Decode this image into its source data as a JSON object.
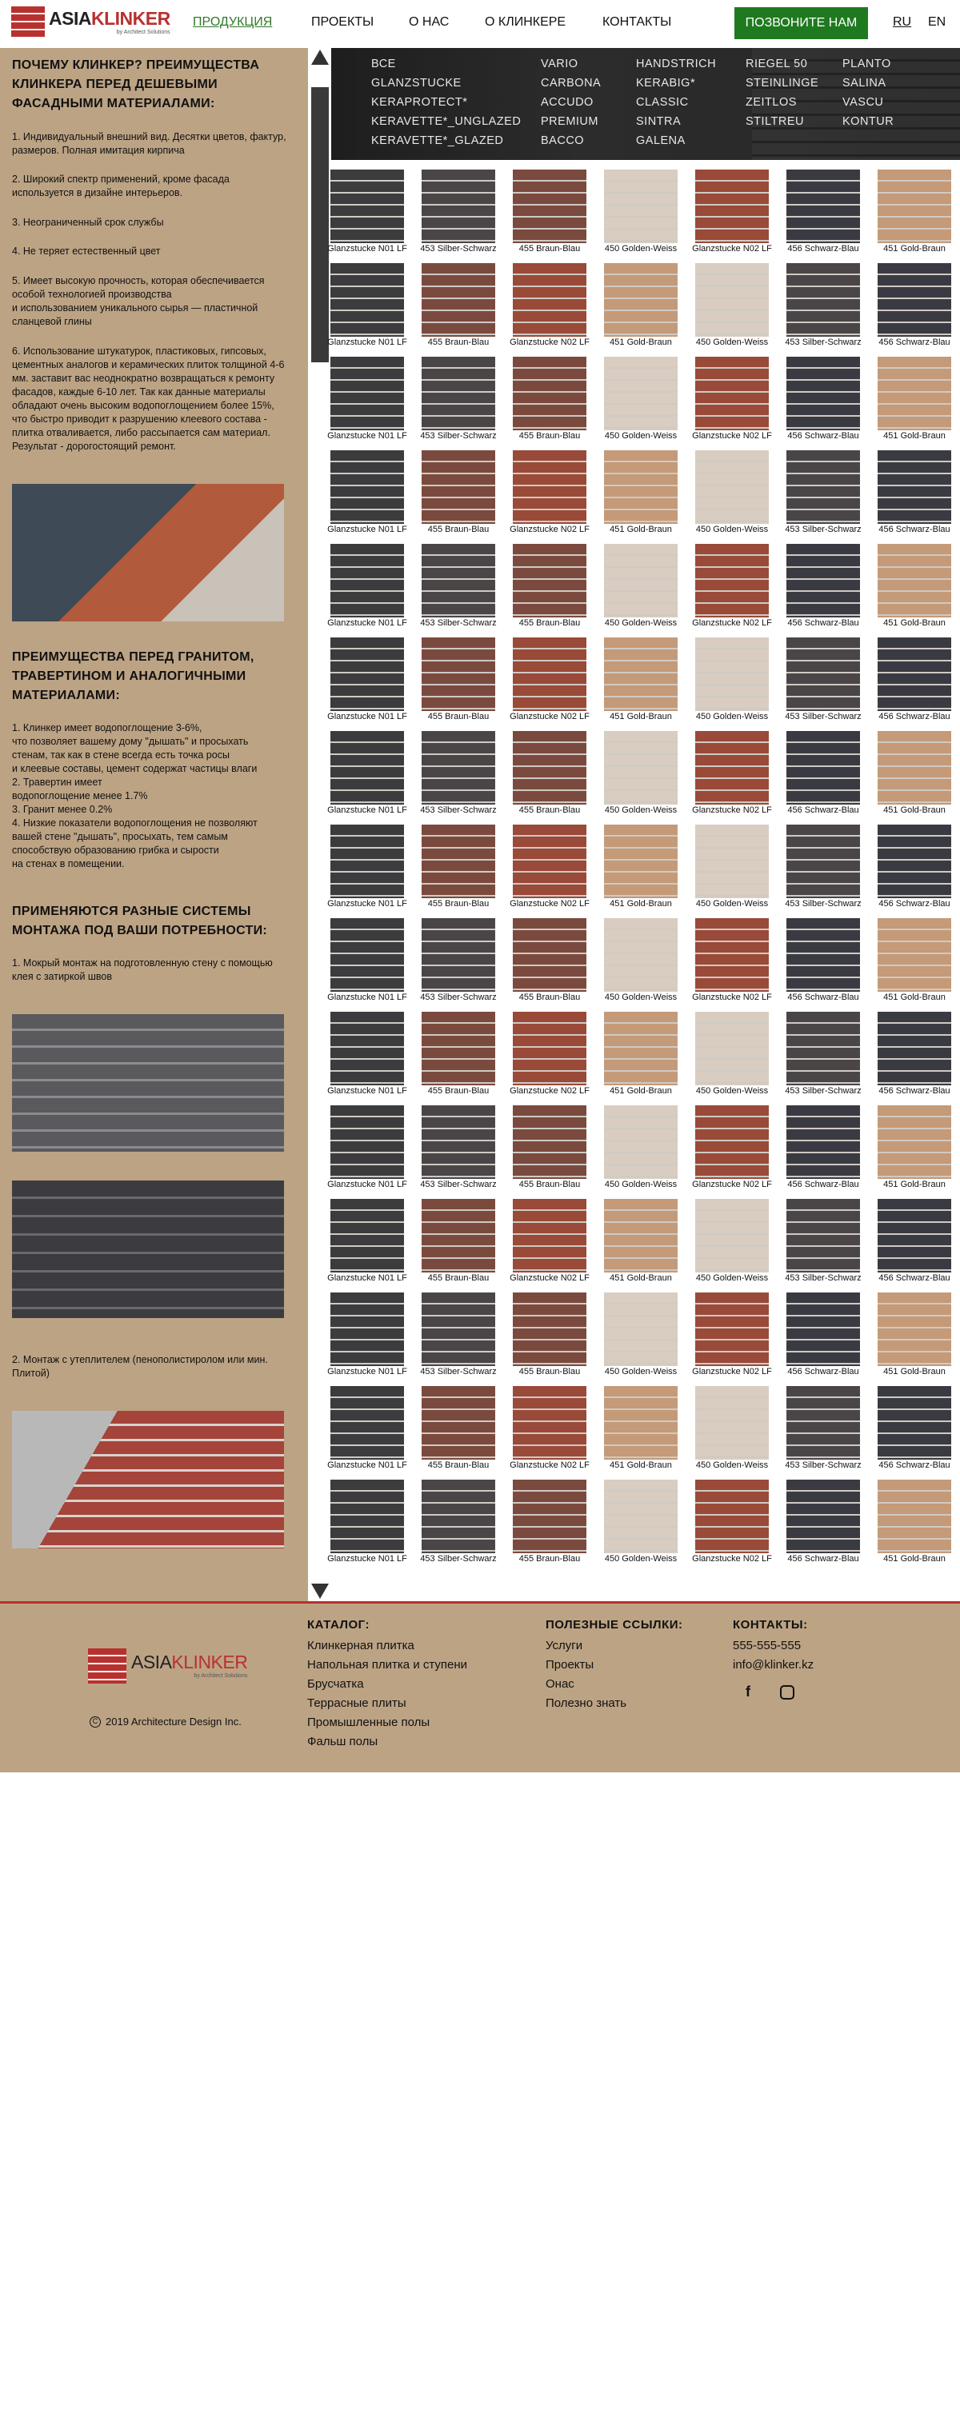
{
  "header": {
    "logo_main": "ASIA",
    "logo_accent": "KLINKER",
    "logo_sub": "by Architect Solutions",
    "nav": [
      "ПРОДУКЦИЯ",
      "ПРОЕКТЫ",
      "О НАС",
      "О КЛИНКЕРЕ",
      "КОНТАКТЫ"
    ],
    "call_label": "ПОЗВОНИТЕ НАМ",
    "langs": [
      "RU",
      "EN"
    ]
  },
  "sidebar": {
    "h1": "ПОЧЕМУ КЛИНКЕР? ПРЕИМУЩЕСТВА КЛИНКЕРА ПЕРЕД ДЕШЕВЫМИ ФАСАДНЫМИ МАТЕРИАЛАМИ:",
    "p1": "1. Индивидуальный внешний вид. Десятки цветов, фактур, размеров. Полная имитация кирпича",
    "p2": "2. Широкий спектр применений, кроме фасада используется в дизайне интерьеров.",
    "p3": "3. Неограниченный срок службы",
    "p4": "4. Не теряет естественный цвет",
    "p5": "5. Имеет высокую прочность, которая обеспечивается особой технологией производства\nи использованием уникального сырья — пластичной сланцевой глины",
    "p6": "6. Использование штукатурок, пластиковых, гипсовых, цементных аналогов и керамических плиток толщиной 4-6 мм. заставит вас неоднократно возвращаться к ремонту фасадов, каждые 6-10 лет. Так как данные материалы обладают очень высоким водопоглощением более 15%, что быстро приводит к разрушению клеевого состава - плитка отваливается, либо рассыпается сам материал. Результат - дорогостоящий ремонт.",
    "h2": "ПРЕИМУЩЕСТВА ПЕРЕД ГРАНИТОМ, ТРАВЕРТИНОМ И АНАЛОГИЧНЫМИ МАТЕРИАЛАМИ:",
    "p7": "1. Клинкер имеет водопоглощение 3-6%,\nчто позволяет вашему дому \"дышать\" и просыхать\nстенам, так как в стене всегда есть точка росы\nи клеевые составы, цемент содержат частицы влаги\n2. Травертин имеет\nводопоглощение менее 1.7%\n3. Гранит менее 0.2%\n4. Низкие показатели водопоглощения не позволяют\nвашей стене \"дышать\", просыхать, тем самым\nспособствую образованию грибка и сырости\nна стенах в помещении.",
    "h3": "ПРИМЕНЯЮТСЯ РАЗНЫЕ СИСТЕМЫ МОНТАЖА ПОД ВАШИ ПОТРЕБНОСТИ:",
    "p8": "1. Мокрый монтаж на подготовленную стену с помощью клея с затиркой швов",
    "p9": "2. Монтаж с утеплителем (пенополистиролом или мин. Плитой)"
  },
  "categories": [
    "ВСЕ",
    "GLANZSTUCKE",
    "KERAPROTECT*",
    "KERAVETTE*_UNGLAZED",
    "KERAVETTE*_GLAZED",
    "VARIO",
    "CARBONA",
    "ACCUDO",
    "PREMIUM",
    "BACCO",
    "HANDSTRICH",
    "KERABIG*",
    "CLASSIC",
    "SINTRA",
    "GALENA",
    "RIEGEL 50",
    "STEINLINGE",
    "ZEITLOS",
    "STILTREU",
    "PLANTO",
    "SALINA",
    "VASCU",
    "KONTUR"
  ],
  "product_rows": [
    [
      "Glanzstucke N01 LF",
      "453 Silber-Schwarz",
      "455 Braun-Blau",
      "450 Golden-Weiss",
      "Glanzstucke N02 LF",
      "456 Schwarz-Blau",
      "451 Gold-Braun"
    ],
    [
      "Glanzstucke N01 LF",
      "455 Braun-Blau",
      "Glanzstucke N02 LF",
      "451 Gold-Braun",
      "450 Golden-Weiss",
      "453 Silber-Schwarz",
      "456 Schwarz-Blau"
    ]
  ],
  "swatch_colors": {
    "Glanzstucke N01 LF": "#3c3c3e",
    "453 Silber-Schwarz": "#4a4648",
    "455 Braun-Blau": "#7b4a3e",
    "450 Golden-Weiss": "#d8cdc0",
    "Glanzstucke N02 LF": "#9a4a38",
    "456 Schwarz-Blau": "#3a3b42",
    "451 Gold-Braun": "#c49a78"
  },
  "footer": {
    "copyright": "2019 Architecture Design Inc.",
    "catalog_title": "КАТАЛОГ:",
    "catalog": [
      "Клинкерная плитка",
      "Напольная плитка и ступени",
      "Брусчатка",
      "Террасные плиты",
      "Промышленные полы",
      "Фальш полы"
    ],
    "links_title": "ПОЛЕЗНЫЕ ССЫЛКИ:",
    "links": [
      "Услуги",
      "Проекты",
      "Онас",
      "Полезно знать"
    ],
    "contacts_title": "КОНТАКТЫ:",
    "phone": "555-555-555",
    "email": "info@klinker.kz"
  }
}
